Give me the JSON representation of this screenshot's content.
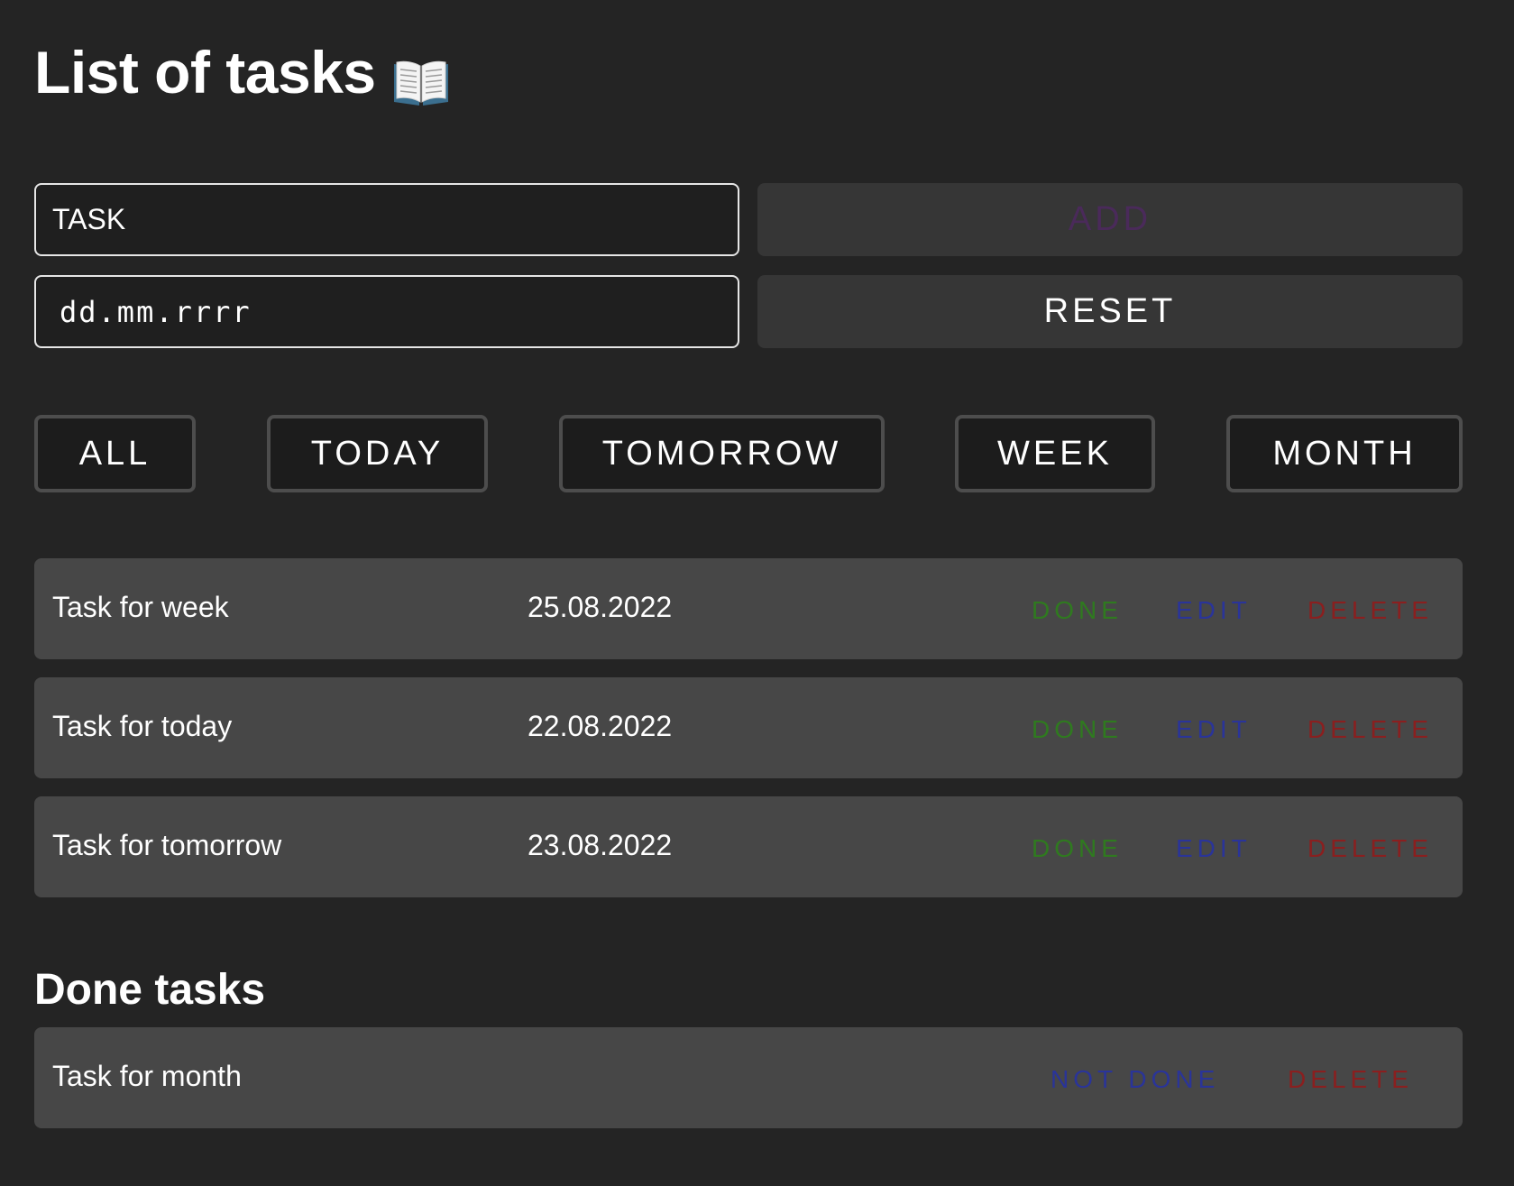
{
  "header": {
    "title": "List of tasks"
  },
  "form": {
    "task_value": "TASK",
    "date_placeholder": "dd.mm.rrrr",
    "add_label": "ADD",
    "reset_label": "RESET"
  },
  "filters": {
    "all": "ALL",
    "today": "TODAY",
    "tomorrow": "TOMORROW",
    "week": "WEEK",
    "month": "MONTH"
  },
  "tasks": [
    {
      "name": "Task for week",
      "date": "25.08.2022",
      "done_label": "DONE",
      "edit_label": "EDIT",
      "delete_label": "DELETE"
    },
    {
      "name": "Task for today",
      "date": "22.08.2022",
      "done_label": "DONE",
      "edit_label": "EDIT",
      "delete_label": "DELETE"
    },
    {
      "name": "Task for tomorrow",
      "date": "23.08.2022",
      "done_label": "DONE",
      "edit_label": "EDIT",
      "delete_label": "DELETE"
    }
  ],
  "done_section": {
    "title": "Done tasks",
    "tasks": [
      {
        "name": "Task for month",
        "not_done_label": "NOT DONE",
        "delete_label": "DELETE"
      }
    ]
  },
  "colors": {
    "background": "#242424",
    "row": "#474747",
    "done": "#2f7a1f",
    "edit": "#2a3499",
    "delete": "#8a1f1f",
    "add": "#4a2a5a"
  },
  "icons": {
    "title_icon": "open-book-icon"
  }
}
